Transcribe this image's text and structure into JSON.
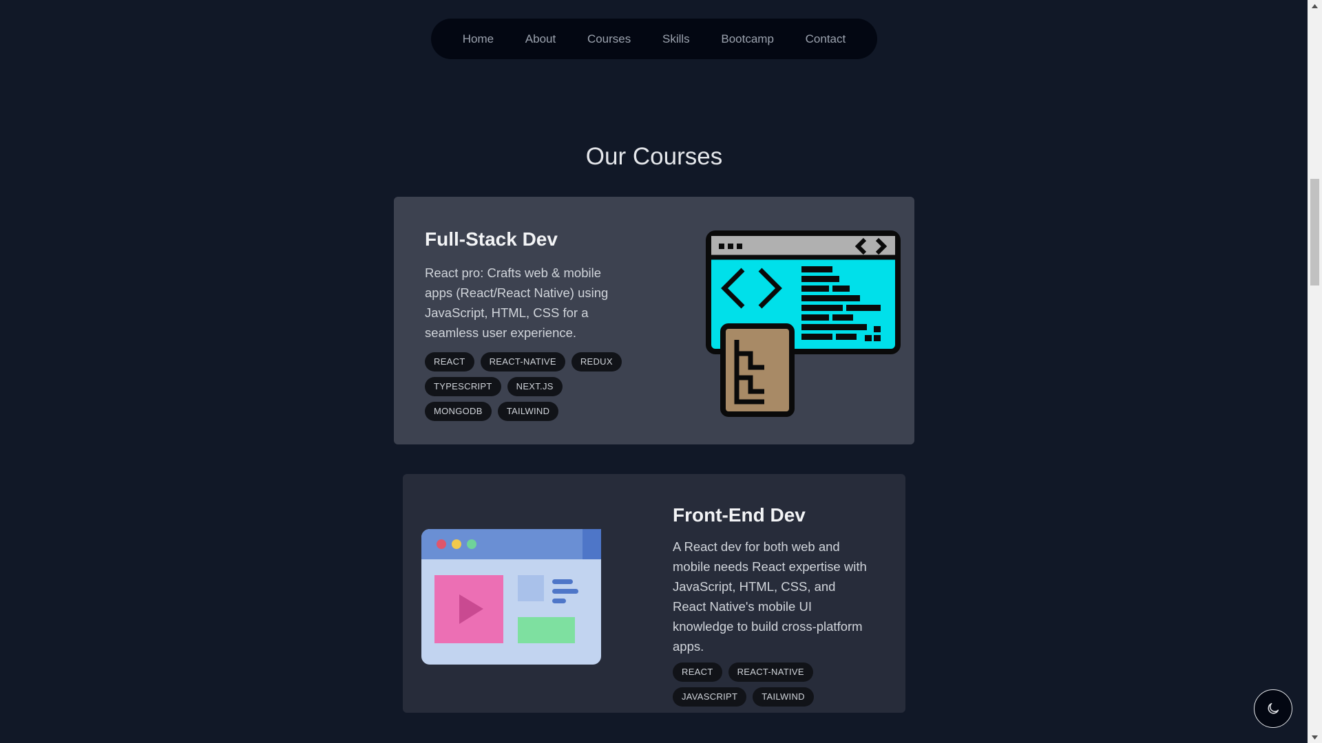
{
  "nav": {
    "items": [
      "Home",
      "About",
      "Courses",
      "Skills",
      "Bootcamp",
      "Contact"
    ]
  },
  "courses_section": {
    "title": "Our Courses"
  },
  "courses": [
    {
      "title": "Full-Stack Dev",
      "description": "React pro: Crafts web & mobile apps (React/React Native) using JavaScript, HTML, CSS for a seamless user experience.",
      "tags": [
        "REACT",
        "REACT-NATIVE",
        "REDUX",
        "TYPESCRIPT",
        "NEXT.JS",
        "MONGODB",
        "TAILWIND"
      ],
      "illustration": "code-editor-sitemap-icon"
    },
    {
      "title": "Front-End Dev",
      "description": "A React dev for both web and mobile needs React expertise with JavaScript, HTML, CSS, and React Native's mobile UI knowledge to build cross-platform apps.",
      "tags": [
        "REACT",
        "REACT-NATIVE",
        "JAVASCRIPT",
        "TAILWIND"
      ],
      "illustration": "browser-video-icon"
    }
  ],
  "theme_toggle": {
    "icon": "moon-icon"
  },
  "colors": {
    "background": "#111827",
    "nav_background": "#030712",
    "card1_background": "#3d4250",
    "card2_background": "#272c3a",
    "accent_cyan": "#00e0ea"
  }
}
